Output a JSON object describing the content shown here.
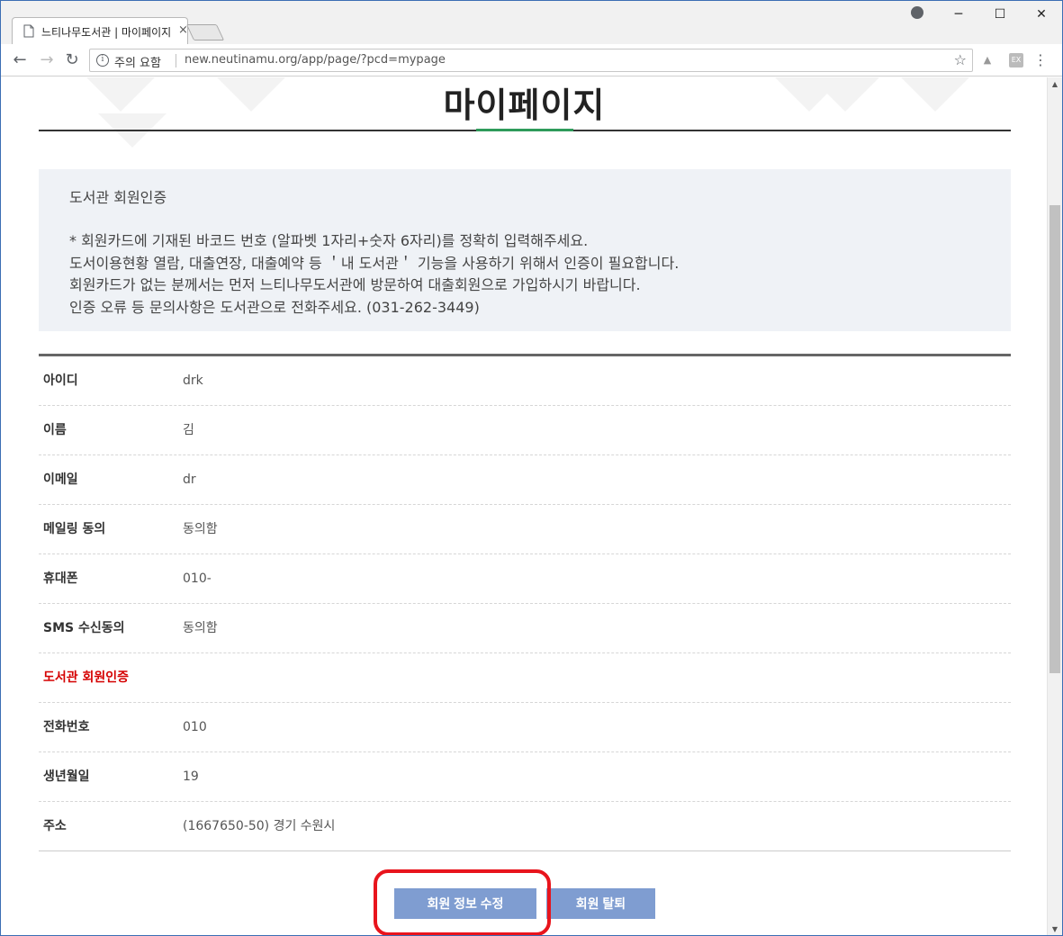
{
  "browser": {
    "tab_title": "느티나무도서관 | 마이페이지",
    "tab_close": "×",
    "window_minimize": "─",
    "window_maximize": "☐",
    "window_close": "✕",
    "security_label": "주의 요함",
    "url": "new.neutinamu.org/app/page/?pcd=mypage",
    "icons": [
      "back-icon",
      "forward-icon",
      "reload-icon",
      "info-icon",
      "star-icon",
      "pdf-extension-icon",
      "extension-icon",
      "menu-icon",
      "profile-icon"
    ]
  },
  "page": {
    "title": "마이페이지",
    "notice": {
      "heading": "도서관 회원인증",
      "lines": [
        "* 회원카드에 기재된 바코드 번호 (알파벳 1자리+숫자 6자리)를 정확히 입력해주세요.",
        "도서이용현황 열람, 대출연장, 대출예약 등 ＇내 도서관＇ 기능을 사용하기 위해서 인증이 필요합니다.",
        "회원카드가 없는 분께서는 먼저 느티나무도서관에 방문하여 대출회원으로 가입하시기 바랍니다.",
        "인증 오류 등 문의사항은 도서관으로 전화주세요. (031-262-3449)"
      ]
    },
    "rows": [
      {
        "label": "아이디",
        "value": "drk"
      },
      {
        "label": "이름",
        "value": "김"
      },
      {
        "label": "이메일",
        "value": "dr"
      },
      {
        "label": "메일링 동의",
        "value": "동의함"
      },
      {
        "label": "휴대폰",
        "value": "010-"
      },
      {
        "label": "SMS 수신동의",
        "value": "동의함"
      },
      {
        "label": "도서관 회원인증",
        "value": ""
      },
      {
        "label": "전화번호",
        "value": "010"
      },
      {
        "label": "생년월일",
        "value": "19"
      },
      {
        "label": "주소",
        "value": "(1667650-50)  경기 수원시"
      }
    ],
    "buttons": {
      "edit": "회원 정보 수정",
      "withdraw": "회원 탈퇴"
    },
    "colors": {
      "button": "#7f9dd1",
      "highlight": "#e8141c",
      "accent": "#2e9b5a",
      "red_label": "#d50000",
      "notice_bg": "#eff2f6"
    }
  }
}
